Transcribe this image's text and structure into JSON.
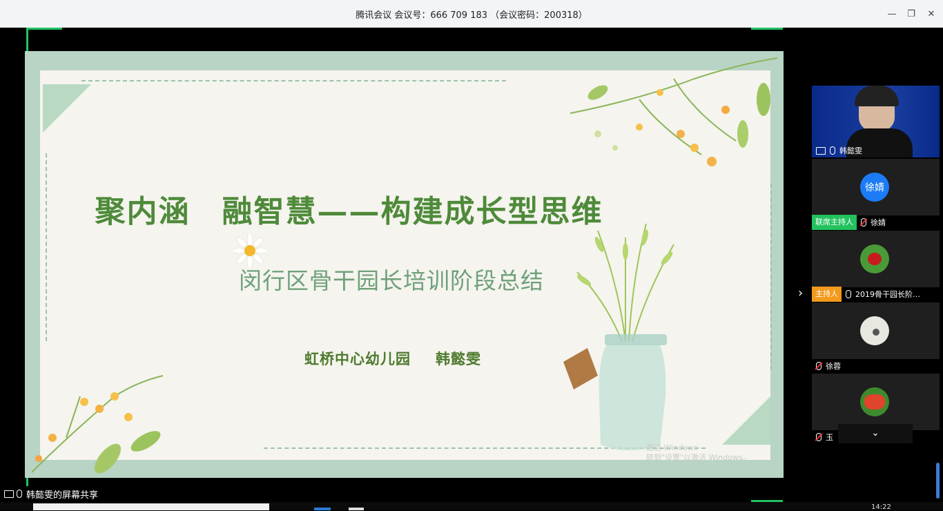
{
  "window": {
    "title": "腾讯会议 会议号：666 709 183 （会议密码：200318）",
    "minimize_icon": "—",
    "restore_icon": "❐",
    "close_icon": "✕"
  },
  "slide": {
    "title": "聚内涵　融智慧——构建成长型思维",
    "subtitle": "闵行区骨干园长培训阶段总结",
    "school": "虹桥中心幼儿园",
    "author": "韩懿雯",
    "watermark_line1": "激活 Windows",
    "watermark_line2": "转到\"设置\"以激活 Windows。"
  },
  "participants": [
    {
      "name": "韩懿雯",
      "tag": "",
      "mic": "on",
      "sharing": true
    },
    {
      "name": "徐婧",
      "tag": "联席主持人",
      "mic": "muted",
      "avatar_text": "徐婧",
      "avatar_color": "#1b7cf5"
    },
    {
      "name": "2019骨干园长阶…",
      "tag": "主持人",
      "mic": "on"
    },
    {
      "name": "徐蓉",
      "tag": "",
      "mic": "muted"
    },
    {
      "name": "玉",
      "tag": "",
      "mic": "muted"
    }
  ],
  "tag_colors": {
    "co_host": "#23c25e",
    "host": "#f29a1d"
  },
  "share_status": "韩懿雯的屏幕共享",
  "clock": "14:22"
}
